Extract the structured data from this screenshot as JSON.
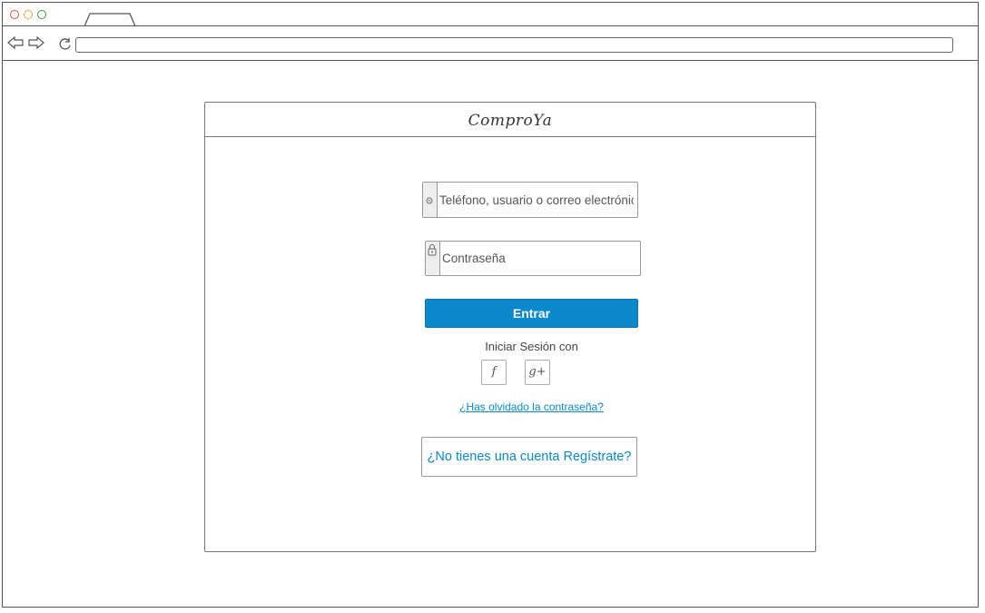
{
  "app": {
    "brand": "ComproYa"
  },
  "login": {
    "user_placeholder": "Teléfono, usuario o correo electrónico",
    "password_placeholder": "Contraseña",
    "submit_label": "Entrar",
    "social_label": "Iniciar Sesión con",
    "social_facebook_glyph": "f",
    "social_google_glyph": "g+",
    "forgot_link": "¿Has olvidado la contraseña?",
    "signup_text": "¿No tienes una cuenta  Regístrate?"
  },
  "icons": {
    "user_field": "user-icon",
    "password_field": "lock-icon",
    "facebook": "facebook-icon",
    "google_plus": "google-plus-icon",
    "back": "back-arrow-icon",
    "forward": "forward-arrow-icon",
    "reload": "reload-icon"
  },
  "colors": {
    "accent": "#0a88cc",
    "button_text": "#ffffff",
    "border": "#777777"
  }
}
